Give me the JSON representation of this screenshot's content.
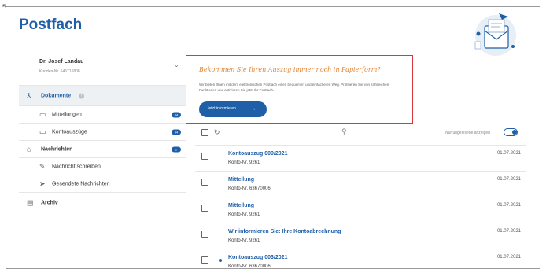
{
  "page": {
    "title": "Postfach"
  },
  "user": {
    "name": "Dr. Josef Landau",
    "customer_id": "Kunden-Nr. 645716808"
  },
  "sidebar": {
    "dokumente": {
      "label": "Dokumente"
    },
    "mitteilungen": {
      "label": "Mitteilungen",
      "badge": "54"
    },
    "kontoauszuege": {
      "label": "Kontoauszüge",
      "badge": "54"
    },
    "nachrichten": {
      "label": "Nachrichten",
      "badge": "2"
    },
    "nachricht_schreiben": {
      "label": "Nachricht schreiben"
    },
    "gesendete": {
      "label": "Gesendete Nachrichten"
    },
    "archiv": {
      "label": "Archiv"
    }
  },
  "promo": {
    "title": "Bekommen Sie Ihren Auszug immer noch in Papierform?",
    "text": "Wir bieten Ihnen mit dem elektronischen Postfach einen bequemen und einfacheren Weg. Profitieren Sie von zahlreichen Funktionen und aktivieren Sie jetzt Ihr Postfach.",
    "button": "Jetzt informieren"
  },
  "toolbar": {
    "unread_only_label": "Nur ungelesene anzeigen",
    "unread_only_enabled": true
  },
  "documents": [
    {
      "title": "Kontoauszug 009/2021",
      "account": "Konto-Nr. 9261",
      "date": "01.07.2021",
      "unread": false
    },
    {
      "title": "Mitteilung",
      "account": "Konto-Nr. 63670006",
      "date": "01.07.2021",
      "unread": false
    },
    {
      "title": "Mitteilung",
      "account": "Konto-Nr. 9261",
      "date": "01.07.2021",
      "unread": false
    },
    {
      "title": "Wir informieren Sie: Ihre Kontoabrechnung",
      "account": "Konto-Nr. 9261",
      "date": "01.07.2021",
      "unread": false
    },
    {
      "title": "Kontoauszug 003/2021",
      "account": "Konto-Nr. 63670006",
      "date": "01.07.2021",
      "unread": true
    }
  ],
  "colors": {
    "brand": "#1f5fa8",
    "promo_border": "#d9363e",
    "promo_title": "#e0842f"
  },
  "icons": {
    "documents": "document-icon",
    "folder": "folder-icon",
    "messages": "inbox-icon",
    "compose": "compose-icon",
    "sent": "send-icon",
    "archive": "archive-icon",
    "refresh": "refresh-icon",
    "search": "search-icon"
  }
}
